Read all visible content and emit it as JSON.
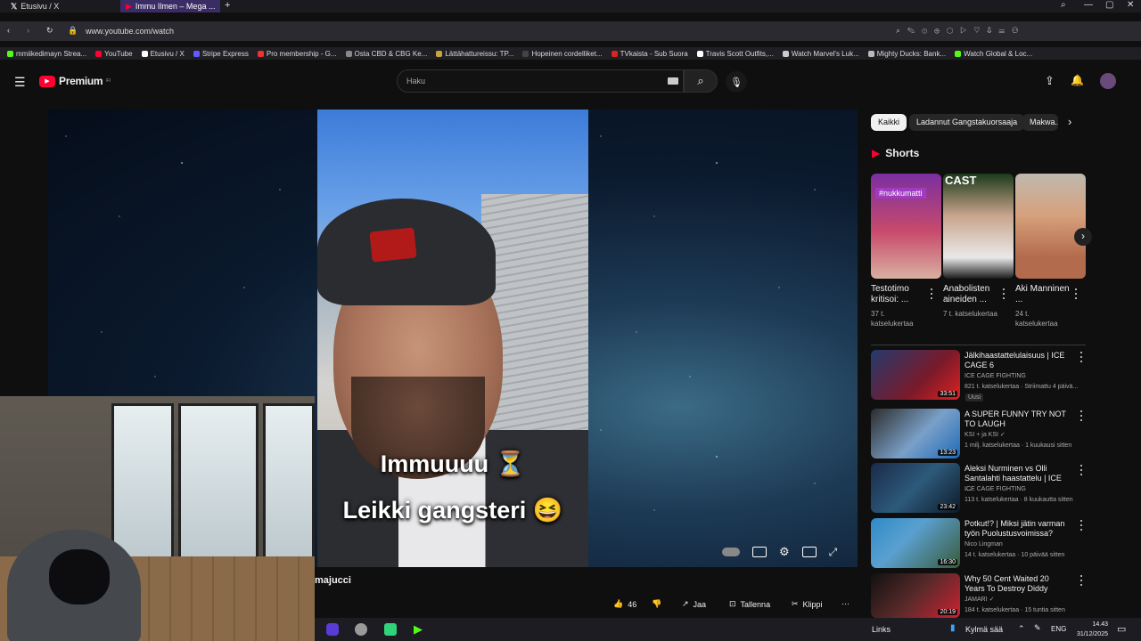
{
  "browser": {
    "tabs": [
      {
        "label": "Etusivu / X",
        "active": false
      },
      {
        "label": "Immu Ilmen – Mega ...",
        "active": true
      }
    ],
    "url": "www.youtube.com/watch",
    "bookmarks": [
      "mmiikedimayn Strea...",
      "YouTube",
      "Etusivu / X",
      "Stripe Express",
      "Pro membership - G...",
      "Osta CBD & CBG Ke...",
      "Lättähattureissu: TP...",
      "Hopeinen cordelliket...",
      "TVkaista - Sub Suora",
      "Travis Scott Outfits,...",
      "Watch Marvel's Luk...",
      "Mighty Ducks: Bank...",
      "Watch Global & Loc..."
    ]
  },
  "youtube": {
    "logo_text": "Premium",
    "logo_sup": "FI",
    "search_placeholder": "Haku",
    "chips": [
      "Kaikki",
      "Ladannut Gangstakuorsaaja",
      "Makwa..."
    ],
    "video": {
      "caption_line1": "Immuuuu ⏳",
      "caption_line2": "Leikki gangsteri 😆",
      "channel_name": "majucci"
    },
    "actions": {
      "likes": "46",
      "share": "Jaa",
      "save": "Tallenna",
      "clip": "Klippi"
    },
    "shorts": {
      "heading": "Shorts",
      "items": [
        {
          "title": "Testotimo kritisoi: ...",
          "views": "37 t. katselukertaa",
          "tag": "#nukkumatti"
        },
        {
          "title": "Anabolisten aineiden ...",
          "views": "7 t. katselukertaa",
          "tag": "CAST"
        },
        {
          "title": "Aki Manninen ...",
          "views": "24 t. katselukertaa",
          "tag": ""
        }
      ]
    },
    "recommendations": [
      {
        "title": "Jälkihaastattelulaisuus | ICE CAGE 6",
        "channel": "ICE CAGE FIGHTING",
        "meta": "821 t. katselukertaa · Striimattu 4 päivä...",
        "badge": "Uusi",
        "duration": "33:51"
      },
      {
        "title": "A SUPER FUNNY TRY NOT TO LAUGH",
        "channel": "KSI + ja KSI ✓",
        "meta": "1 milj. katselukertaa · 1 kuukausi sitten",
        "badge": "",
        "duration": "13:23"
      },
      {
        "title": "Aleksi Nurminen vs Olli Santalahti haastattelu | ICE ...",
        "channel": "ICE CAGE FIGHTING",
        "meta": "113 t. katselukertaa · 8 kuukautta sitten",
        "badge": "",
        "duration": "23:42"
      },
      {
        "title": "Potkut!? | Miksi jätin varman työn Puolustusvoimissa?",
        "channel": "Nico Lingman",
        "meta": "14 t. katselukertaa · 10 päivää sitten",
        "badge": "",
        "duration": "16:30"
      },
      {
        "title": "Why 50 Cent Waited 20 Years To Destroy Diddy",
        "channel": "JAMARI ✓",
        "meta": "184 t. katselukertaa · 15 tuntia sitten",
        "badge": "",
        "duration": "20:19"
      }
    ]
  },
  "taskbar": {
    "links_label": "Links",
    "weather": "Kylmä sää",
    "lang": "ENG",
    "time": "14.43",
    "date": "31/12/2025"
  },
  "colors": {
    "accent_red": "#ff0033",
    "bg": "#0f0f0f",
    "tab_active": "#3a2d66"
  }
}
